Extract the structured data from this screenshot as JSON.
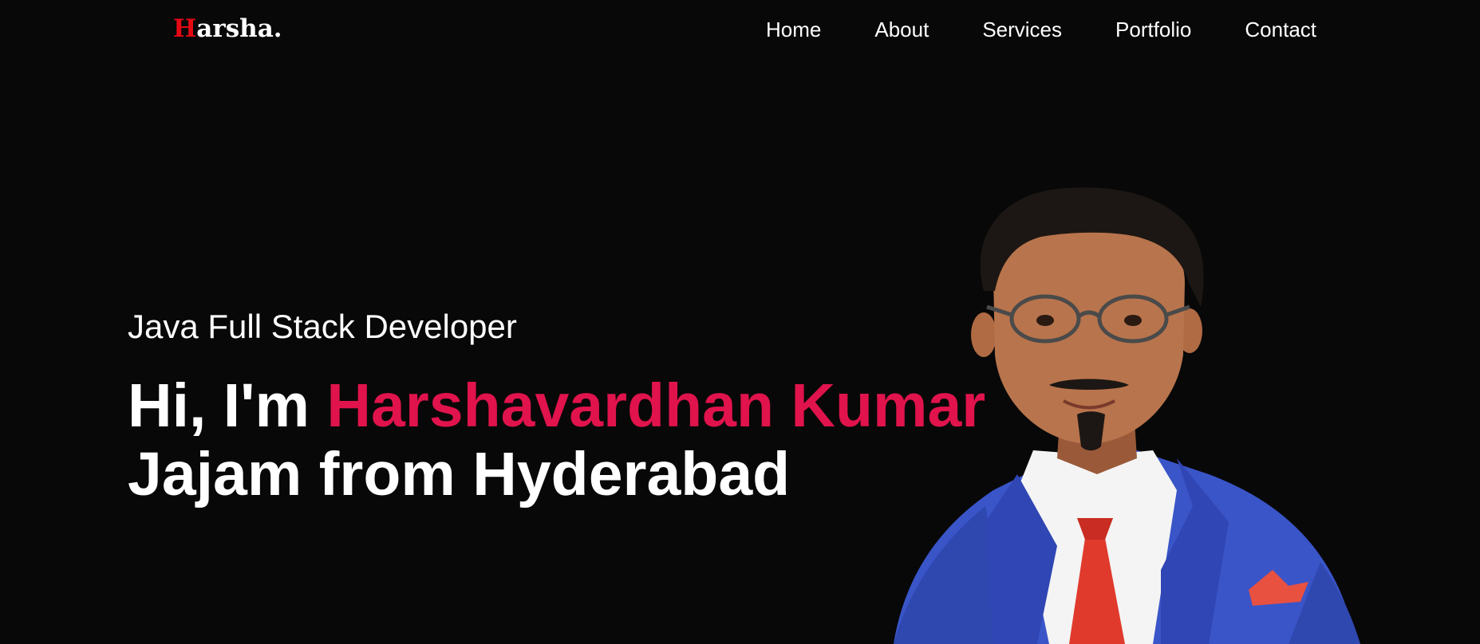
{
  "navbar": {
    "logo_first": "H",
    "logo_rest": "arsha.",
    "links": [
      "Home",
      "About",
      "Services",
      "Portfolio",
      "Contact"
    ]
  },
  "hero": {
    "role": "Java Full Stack Developer",
    "greeting": "Hi, I'm ",
    "name_highlight": "Harshavardhan Kumar",
    "name_rest": "Jajam from Hyderabad"
  },
  "colors": {
    "background": "#080808",
    "logo_accent": "#e50914",
    "name_accent": "#e0134c",
    "suit": "#3a55c8",
    "tie": "#e03a2c"
  },
  "icons": {
    "portrait": "person-portrait-icon"
  }
}
